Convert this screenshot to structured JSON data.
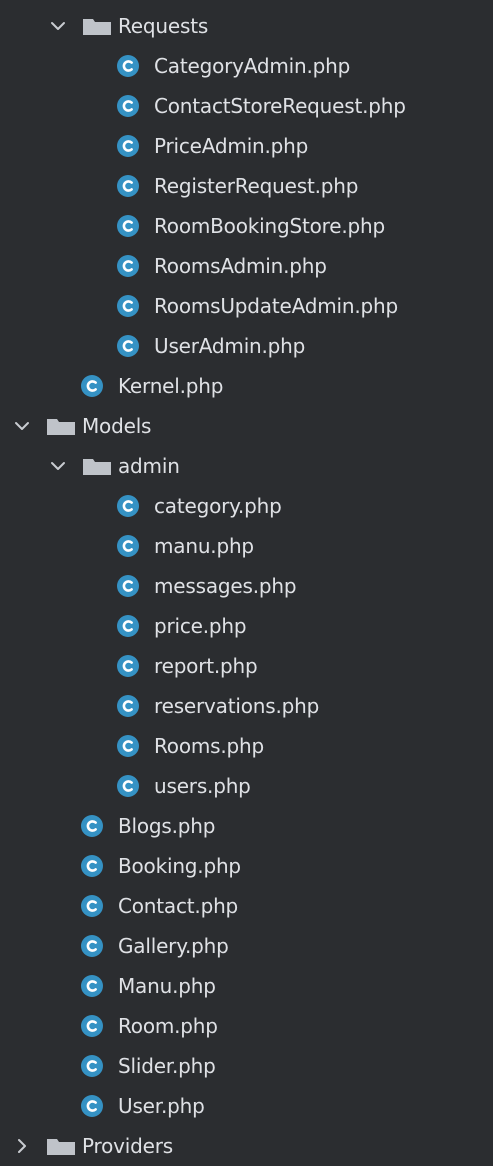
{
  "project_tree": {
    "nodes": [
      {
        "type": "folder",
        "label": "Requests",
        "depth": 1,
        "expanded": true
      },
      {
        "type": "file",
        "label": "CategoryAdmin.php",
        "depth": 2
      },
      {
        "type": "file",
        "label": "ContactStoreRequest.php",
        "depth": 2
      },
      {
        "type": "file",
        "label": "PriceAdmin.php",
        "depth": 2
      },
      {
        "type": "file",
        "label": "RegisterRequest.php",
        "depth": 2
      },
      {
        "type": "file",
        "label": "RoomBookingStore.php",
        "depth": 2
      },
      {
        "type": "file",
        "label": "RoomsAdmin.php",
        "depth": 2
      },
      {
        "type": "file",
        "label": "RoomsUpdateAdmin.php",
        "depth": 2
      },
      {
        "type": "file",
        "label": "UserAdmin.php",
        "depth": 2
      },
      {
        "type": "file",
        "label": "Kernel.php",
        "depth": 1
      },
      {
        "type": "folder",
        "label": "Models",
        "depth": 0,
        "expanded": true
      },
      {
        "type": "folder",
        "label": "admin",
        "depth": 1,
        "expanded": true
      },
      {
        "type": "file",
        "label": "category.php",
        "depth": 2
      },
      {
        "type": "file",
        "label": "manu.php",
        "depth": 2
      },
      {
        "type": "file",
        "label": "messages.php",
        "depth": 2
      },
      {
        "type": "file",
        "label": "price.php",
        "depth": 2
      },
      {
        "type": "file",
        "label": "report.php",
        "depth": 2
      },
      {
        "type": "file",
        "label": "reservations.php",
        "depth": 2
      },
      {
        "type": "file",
        "label": "Rooms.php",
        "depth": 2
      },
      {
        "type": "file",
        "label": "users.php",
        "depth": 2
      },
      {
        "type": "file",
        "label": "Blogs.php",
        "depth": 1
      },
      {
        "type": "file",
        "label": "Booking.php",
        "depth": 1
      },
      {
        "type": "file",
        "label": "Contact.php",
        "depth": 1
      },
      {
        "type": "file",
        "label": "Gallery.php",
        "depth": 1
      },
      {
        "type": "file",
        "label": "Manu.php",
        "depth": 1
      },
      {
        "type": "file",
        "label": "Room.php",
        "depth": 1
      },
      {
        "type": "file",
        "label": "Slider.php",
        "depth": 1
      },
      {
        "type": "file",
        "label": "User.php",
        "depth": 1
      },
      {
        "type": "folder",
        "label": "Providers",
        "depth": 0,
        "expanded": false
      }
    ]
  },
  "icons": {
    "folder": "folder-icon",
    "file": "php-class-icon",
    "expanded": "chevron-down-icon",
    "collapsed": "chevron-right-icon"
  },
  "colors": {
    "background": "#2b2d30",
    "text": "#dfe1e5",
    "class_icon": "#3592c4",
    "folder_icon": "#bfc3c9",
    "chevron": "#c9ccd1"
  }
}
